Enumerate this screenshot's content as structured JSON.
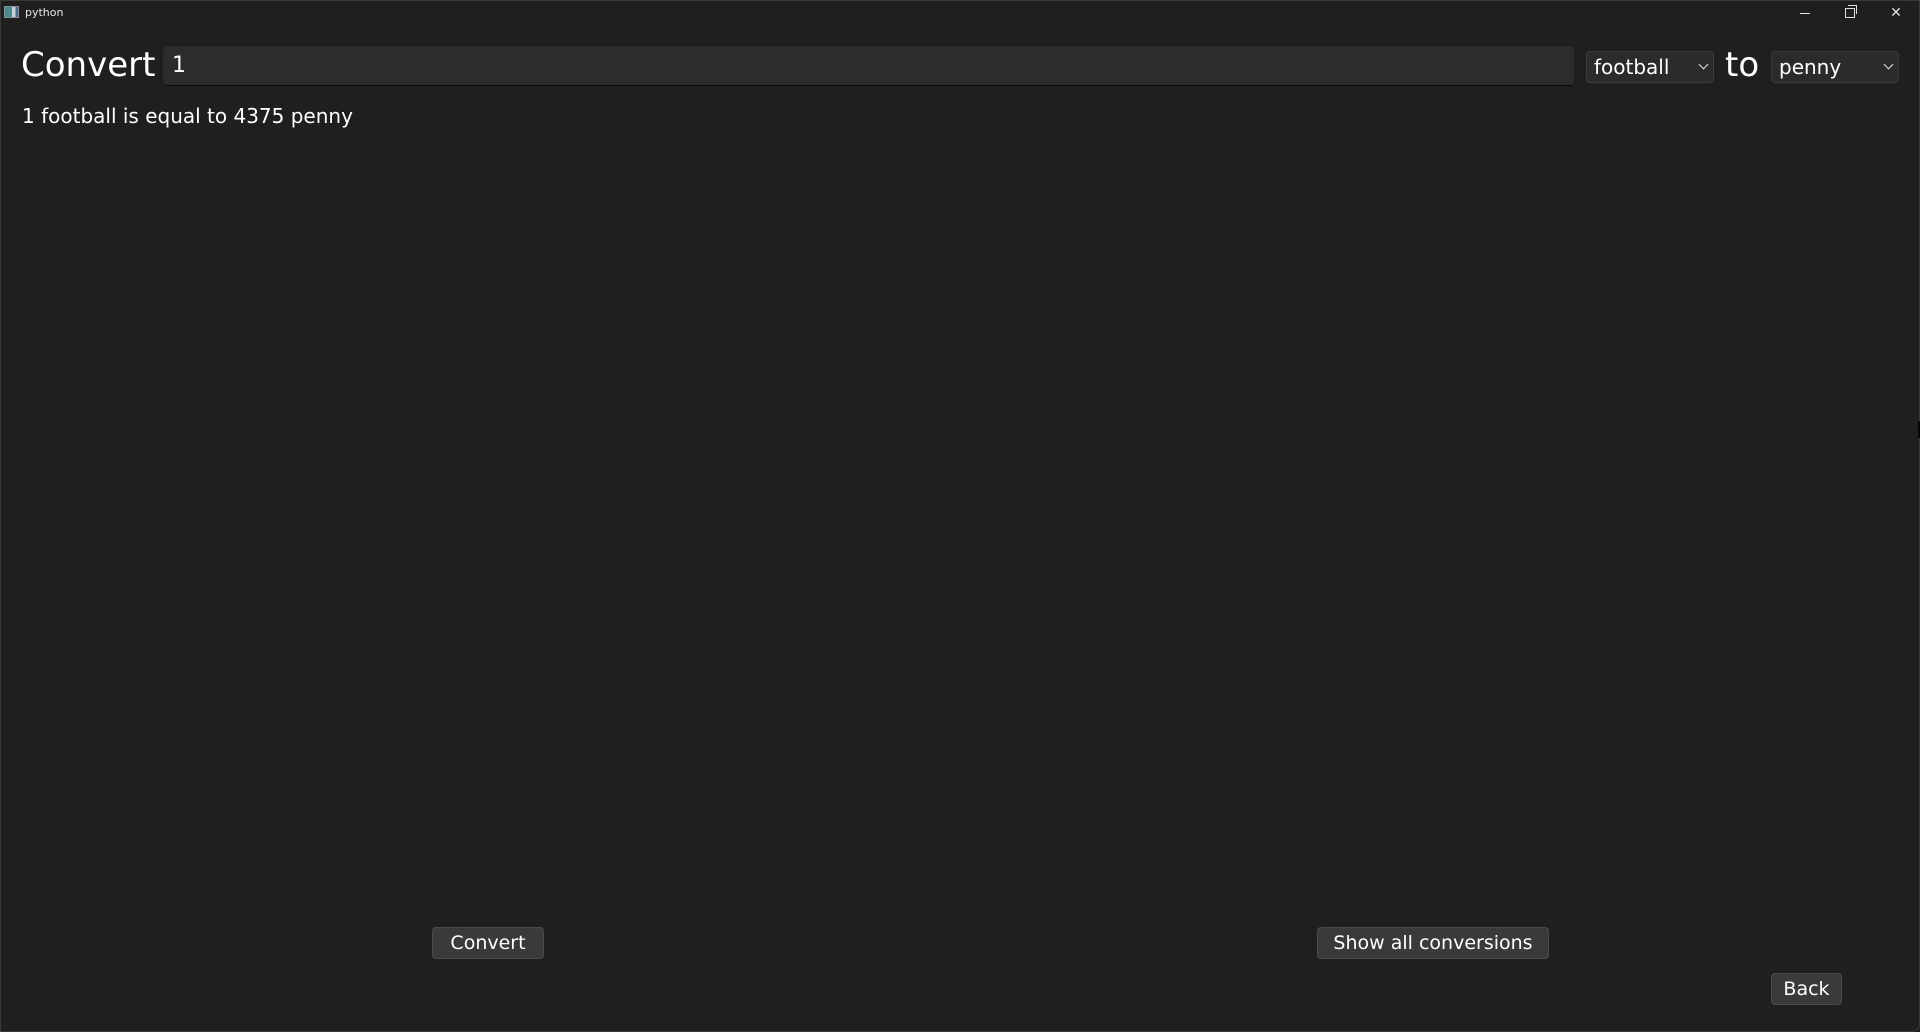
{
  "window": {
    "title": "python",
    "icon": "python-app-icon",
    "controls": [
      "minimize-icon",
      "restore-icon",
      "close-icon"
    ]
  },
  "form": {
    "convert_label": "Convert",
    "value_input": "1",
    "from_unit": "football",
    "to_label": "to",
    "to_unit": "penny"
  },
  "result": {
    "text": "1 football is equal to 4375 penny"
  },
  "buttons": {
    "convert": "Convert",
    "show_all": "Show all conversions",
    "back": "Back"
  }
}
